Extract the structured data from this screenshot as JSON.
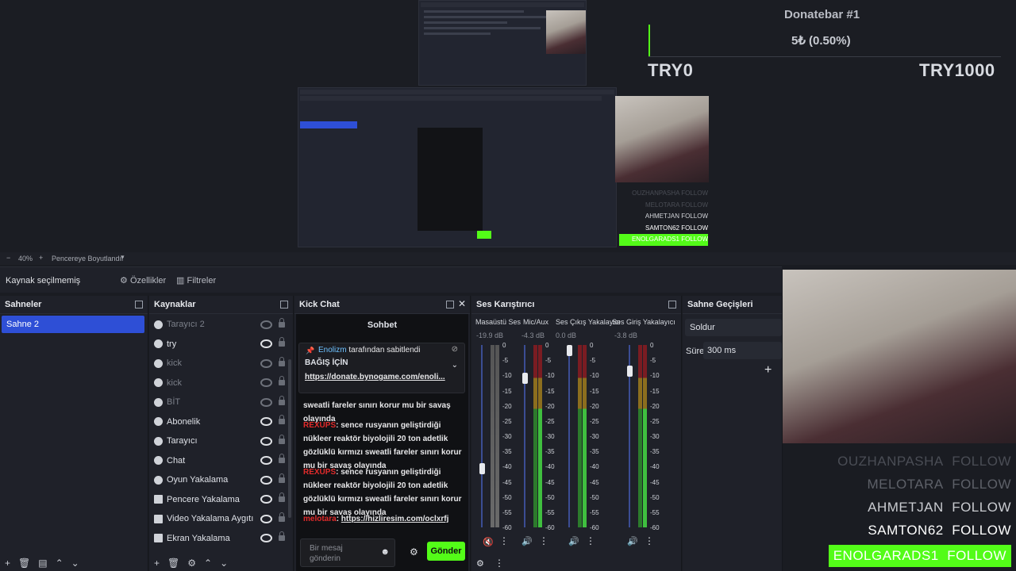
{
  "preview": {
    "donatebar_title": "Donatebar #1",
    "donatebar_amount": "5₺ (0.50%)",
    "donate_min": "TRY0",
    "donate_max": "TRY1000",
    "mini_follows": [
      "OUZHANPASHA FOLLOW",
      "MELOTARA FOLLOW",
      "AHMETJAN FOLLOW",
      "SAMTON62 FOLLOW",
      "ENOLGARADS1 FOLLOW"
    ]
  },
  "zoom": {
    "minus": "−",
    "level": "40%",
    "plus": "+",
    "fit_label": "Pencereye Boyutlandır"
  },
  "toolbar": {
    "no_source": "Kaynak seçilmemiş",
    "properties": "Özellikler",
    "filters": "Filtreler"
  },
  "scenes": {
    "title": "Sahneler",
    "items": [
      "Sahne 2"
    ]
  },
  "sources": {
    "title": "Kaynaklar",
    "items": [
      {
        "label": "Tarayıcı 2",
        "visible": false
      },
      {
        "label": "try",
        "visible": true
      },
      {
        "label": "kick",
        "visible": false
      },
      {
        "label": "kick",
        "visible": false
      },
      {
        "label": "BİT",
        "visible": false
      },
      {
        "label": "Abonelik",
        "visible": true
      },
      {
        "label": "Tarayıcı",
        "visible": true
      },
      {
        "label": "Chat",
        "visible": true
      },
      {
        "label": "Oyun Yakalama",
        "visible": true
      },
      {
        "label": "Pencere Yakalama",
        "visible": true
      },
      {
        "label": "Video Yakalama Aygıtı",
        "visible": true
      },
      {
        "label": "Ekran Yakalama",
        "visible": true
      }
    ]
  },
  "chat": {
    "dock_title": "Kick Chat",
    "header": "Sohbet",
    "pinned_user": "Enolizm",
    "pinned_by": "tarafından sabitlendi",
    "pinned_title": "BAĞIŞ İÇİN",
    "pinned_link": "https://donate.bynogame.com/enoli...",
    "partial_line": "sweatli fareler sınırı korur mu bir savaş olayında",
    "messages": [
      {
        "user": "REXUPS",
        "text": ": sence rusyanın geliştirdiği nükleer reaktör biyolojili 20 ton adetlik gözlüklü kırmızı sweatli fareler sınırı korur mu bir savaş olayında"
      },
      {
        "user": "REXUPS",
        "text": ": sence rusyanın geliştirdiği nükleer reaktör biyolojili 20 ton adetlik gözlüklü kırmızı sweatli fareler sınırı korur mu bir savaş olayında"
      }
    ],
    "last_user": "melotara",
    "last_link": "https://hizliresim.com/oclxrfj",
    "input_placeholder": "Bir mesaj gönderin",
    "send_label": "Gönder"
  },
  "mixer": {
    "title": "Ses Karıştırıcı",
    "channels": [
      {
        "name": "Masaüstü Ses",
        "db": "-19.9 dB",
        "level": 0.31,
        "muted": true
      },
      {
        "name": "Mic/Aux",
        "db": "-4.3 dB",
        "level": 0.84,
        "muted": false
      },
      {
        "name": "Ses Çıkış Yakalayıcı",
        "db": "0.0 dB",
        "level": 1.0,
        "muted": false
      },
      {
        "name": "Ses Giriş Yakalayıcı",
        "db": "-3.8 dB",
        "level": 0.88,
        "muted": false
      }
    ],
    "scale": [
      "0",
      "-5",
      "-10",
      "-15",
      "-20",
      "-25",
      "-30",
      "-35",
      "-40",
      "-45",
      "-50",
      "-55",
      "-60"
    ]
  },
  "transitions": {
    "title": "Sahne Geçişleri",
    "selected": "Soldur",
    "duration_label": "Süre",
    "duration_value": "300 ms"
  },
  "follows": [
    {
      "user": "OUZHANPASHA",
      "action": "FOLLOW",
      "shade": "#4a4d55"
    },
    {
      "user": "MELOTARA",
      "action": "FOLLOW",
      "shade": "#5d6068"
    },
    {
      "user": "AHMETJAN",
      "action": "FOLLOW",
      "shade": "#c9cbd0"
    },
    {
      "user": "SAMTON62",
      "action": "FOLLOW",
      "shade": "#ffffff"
    },
    {
      "user": "ENOLGARADS1",
      "action": "FOLLOW",
      "shade": "#ffffff"
    }
  ],
  "colors": {
    "accent_green": "#53fc18",
    "selection_blue": "#2e4fd6",
    "kick_red": "#e02b2b"
  }
}
